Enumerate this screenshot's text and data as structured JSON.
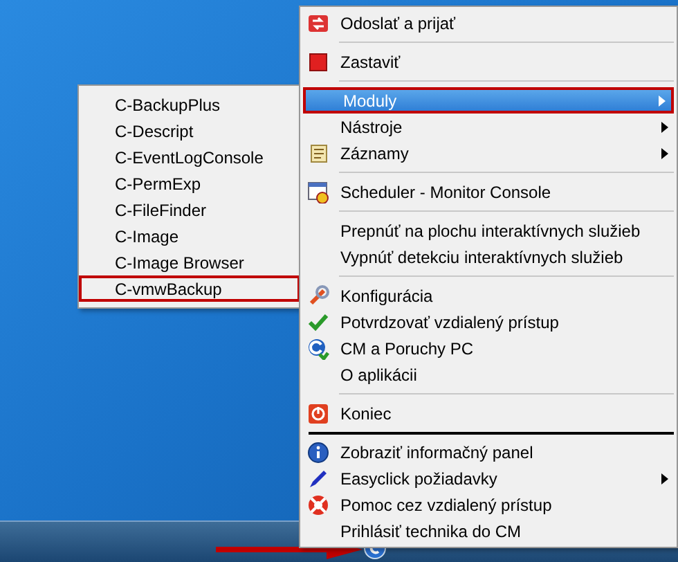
{
  "main_menu": {
    "items": [
      {
        "kind": "item",
        "label": "Odoslať a prijať",
        "selected": false,
        "outlined": false,
        "submenu": false
      },
      {
        "kind": "separator"
      },
      {
        "kind": "item",
        "label": "Zastaviť",
        "selected": false,
        "outlined": false,
        "submenu": false
      },
      {
        "kind": "separator"
      },
      {
        "kind": "item",
        "label": "Moduly",
        "selected": true,
        "outlined": true,
        "submenu": true
      },
      {
        "kind": "item",
        "label": "Nástroje",
        "selected": false,
        "outlined": false,
        "submenu": true
      },
      {
        "kind": "item",
        "label": "Záznamy",
        "selected": false,
        "outlined": false,
        "submenu": true
      },
      {
        "kind": "separator"
      },
      {
        "kind": "item",
        "label": "Scheduler - Monitor Console",
        "selected": false,
        "outlined": false,
        "submenu": false
      },
      {
        "kind": "separator"
      },
      {
        "kind": "item",
        "label": "Prepnúť na plochu interaktívnych služieb",
        "selected": false,
        "outlined": false,
        "submenu": false
      },
      {
        "kind": "item",
        "label": "Vypnúť detekciu interaktívnych služieb",
        "selected": false,
        "outlined": false,
        "submenu": false
      },
      {
        "kind": "separator"
      },
      {
        "kind": "item",
        "label": "Konfigurácia",
        "selected": false,
        "outlined": false,
        "submenu": false
      },
      {
        "kind": "item",
        "label": "Potvrdzovať vzdialený prístup",
        "selected": false,
        "outlined": false,
        "submenu": false
      },
      {
        "kind": "item",
        "label": "CM a Poruchy PC",
        "selected": false,
        "outlined": false,
        "submenu": false
      },
      {
        "kind": "item",
        "label": "O aplikácii",
        "selected": false,
        "outlined": false,
        "submenu": false
      },
      {
        "kind": "separator"
      },
      {
        "kind": "item",
        "label": "Koniec",
        "selected": false,
        "outlined": false,
        "submenu": false
      },
      {
        "kind": "thick_separator"
      },
      {
        "kind": "item",
        "label": "Zobraziť informačný panel",
        "selected": false,
        "outlined": false,
        "submenu": false
      },
      {
        "kind": "item",
        "label": "Easyclick požiadavky",
        "selected": false,
        "outlined": false,
        "submenu": true
      },
      {
        "kind": "item",
        "label": "Pomoc cez vzdialený prístup",
        "selected": false,
        "outlined": false,
        "submenu": false
      },
      {
        "kind": "item",
        "label": "Prihlásiť technika do CM",
        "selected": false,
        "outlined": false,
        "submenu": false
      }
    ]
  },
  "modules_submenu": {
    "items": [
      {
        "label": "C-BackupPlus",
        "outlined": false
      },
      {
        "label": "C-Descript",
        "outlined": false
      },
      {
        "label": "C-EventLogConsole",
        "outlined": false
      },
      {
        "label": "C-PermExp",
        "outlined": false
      },
      {
        "label": "C-FileFinder",
        "outlined": false
      },
      {
        "label": "C-Image",
        "outlined": false
      },
      {
        "label": "C-Image Browser",
        "outlined": false
      },
      {
        "label": "C-vmwBackup",
        "outlined": true
      }
    ]
  }
}
